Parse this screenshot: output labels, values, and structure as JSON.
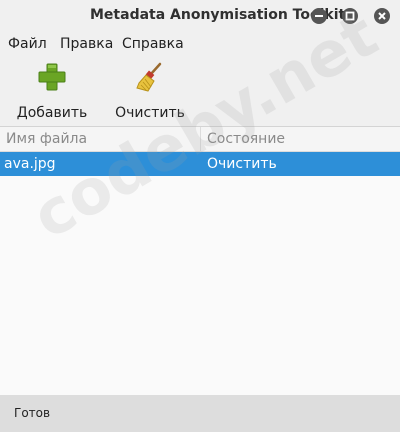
{
  "window": {
    "title": "Metadata Anonymisation Toolkit",
    "controls": [
      {
        "name": "minimize",
        "icon": "minimize-icon"
      },
      {
        "name": "maximize",
        "icon": "maximize-icon"
      },
      {
        "name": "close",
        "icon": "close-icon"
      }
    ]
  },
  "menu": {
    "items": [
      "Файл",
      "Правка",
      "Справка"
    ]
  },
  "toolbar": {
    "add_label": "Добавить",
    "add_icon": "plus-icon",
    "clean_label": "Очистить",
    "clean_icon": "broom-icon"
  },
  "table": {
    "columns": [
      "Имя файла",
      "Состояние"
    ],
    "rows": [
      {
        "file": "ava.jpg",
        "state": "Очистить",
        "selected": true
      }
    ]
  },
  "watermark": "codeby.net",
  "status": {
    "text": "Готов"
  },
  "colors": {
    "selection": "#2d8fd8",
    "add_icon": "#6aa524",
    "title_controls": "#555555"
  }
}
